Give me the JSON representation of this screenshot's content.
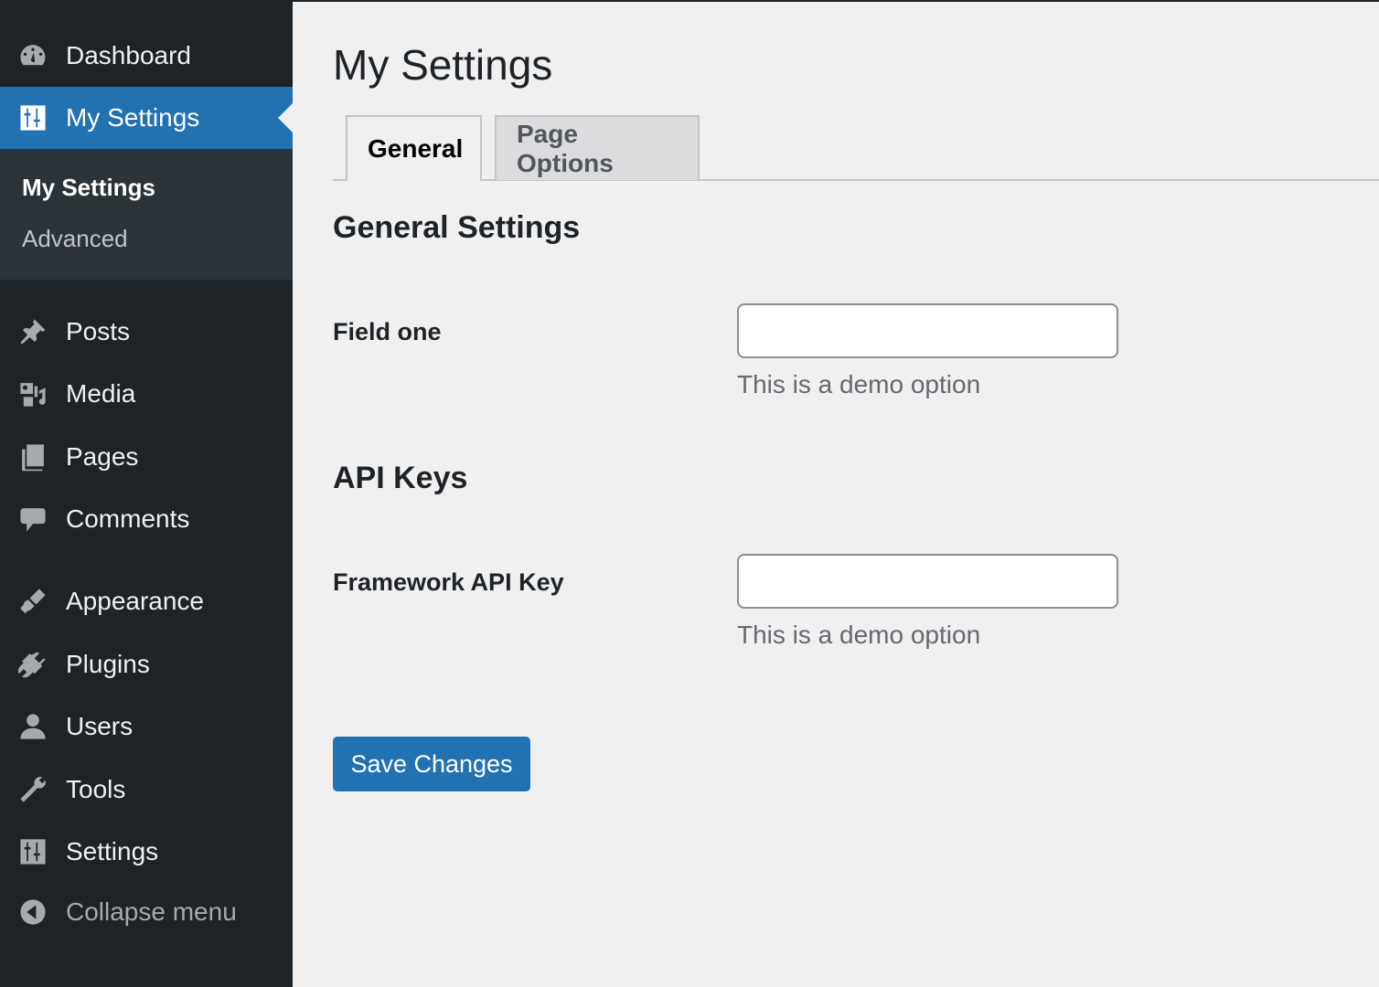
{
  "sidebar": {
    "items": [
      {
        "label": "Dashboard",
        "icon": "dashboard-icon"
      },
      {
        "label": "My Settings",
        "icon": "settings-sliders-icon"
      },
      {
        "label": "Posts",
        "icon": "pushpin-icon"
      },
      {
        "label": "Media",
        "icon": "media-icon"
      },
      {
        "label": "Pages",
        "icon": "pages-icon"
      },
      {
        "label": "Comments",
        "icon": "comment-icon"
      },
      {
        "label": "Appearance",
        "icon": "paintbrush-icon"
      },
      {
        "label": "Plugins",
        "icon": "plug-icon"
      },
      {
        "label": "Users",
        "icon": "user-icon"
      },
      {
        "label": "Tools",
        "icon": "wrench-icon"
      },
      {
        "label": "Settings",
        "icon": "settings-sliders-icon"
      },
      {
        "label": "Collapse menu",
        "icon": "collapse-arrow-icon"
      }
    ],
    "submenu": [
      {
        "label": "My Settings"
      },
      {
        "label": "Advanced"
      }
    ]
  },
  "main": {
    "title": "My Settings",
    "tabs": [
      {
        "label": "General"
      },
      {
        "label": "Page Options"
      }
    ],
    "sections": [
      {
        "title": "General Settings",
        "field_label": "Field one",
        "value": "",
        "description": "This is a demo option"
      },
      {
        "title": "API Keys",
        "field_label": "Framework API Key",
        "value": "",
        "description": "This is a demo option"
      }
    ],
    "save_label": "Save Changes"
  },
  "colors": {
    "sidebar_bg": "#1d2327",
    "accent": "#2271b1",
    "page_bg": "#f0f0f1"
  }
}
